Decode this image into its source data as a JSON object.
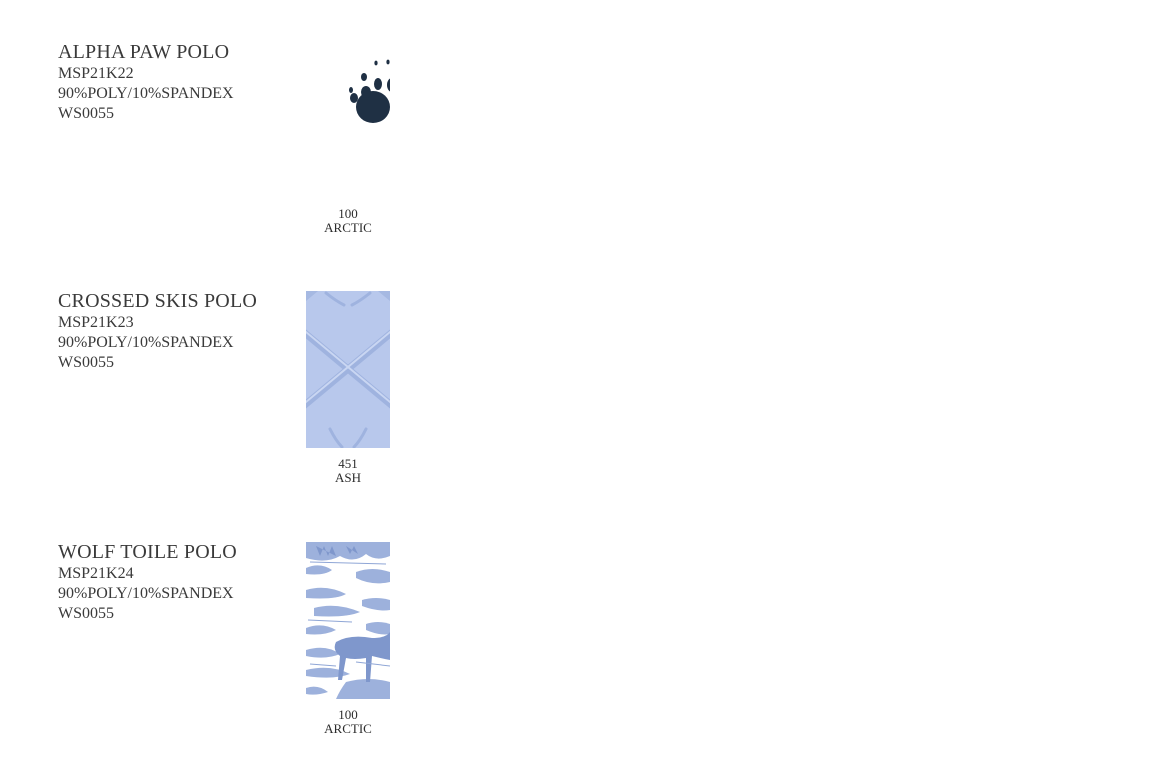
{
  "products": [
    {
      "name": "ALPHA PAW POLO",
      "style_number": "MSP21K22",
      "fabric": "90%POLY/10%SPANDEX",
      "fabric_code": "WS0055",
      "swatch": {
        "icon": "paw-print-icon",
        "color_number": "100",
        "color_name": "ARCTIC",
        "ink": "#1f3044",
        "ground": "#ffffff"
      }
    },
    {
      "name": "CROSSED SKIS POLO",
      "style_number": "MSP21K23",
      "fabric": "90%POLY/10%SPANDEX",
      "fabric_code": "WS0055",
      "swatch": {
        "icon": "crossed-skis-pattern",
        "color_number": "451",
        "color_name": "ASH",
        "ink": "#a0b6e0",
        "ground": "#b8c8ec"
      }
    },
    {
      "name": "WOLF TOILE POLO",
      "style_number": "MSP21K24",
      "fabric": "90%POLY/10%SPANDEX",
      "fabric_code": "WS0055",
      "swatch": {
        "icon": "wolf-toile-pattern",
        "color_number": "100",
        "color_name": "ARCTIC",
        "ink": "#8fa6d6",
        "ground": "#ffffff"
      }
    }
  ]
}
